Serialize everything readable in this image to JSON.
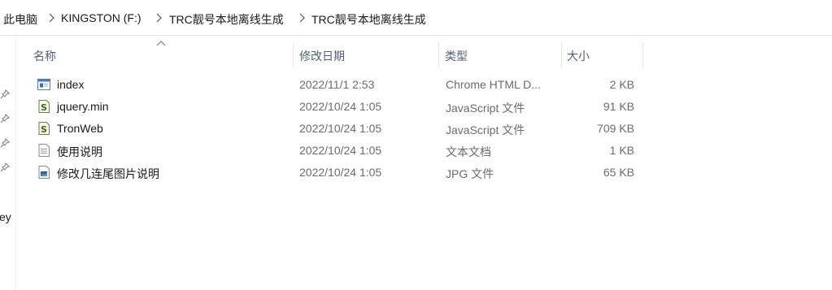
{
  "breadcrumb": {
    "items": [
      "此电脑",
      "KINGSTON (F:)",
      "TRC靓号本地离线生成",
      "TRC靓号本地离线生成"
    ]
  },
  "nav": {
    "partial_text": "key"
  },
  "columns": {
    "name": "名称",
    "date": "修改日期",
    "type": "类型",
    "size": "大小"
  },
  "files": [
    {
      "name": "index",
      "date": "2022/11/1 2:53",
      "type": "Chrome HTML D...",
      "size": "2 KB",
      "icon": "html-file-icon"
    },
    {
      "name": "jquery.min",
      "date": "2022/10/24 1:05",
      "type": "JavaScript 文件",
      "size": "91 KB",
      "icon": "js-file-icon"
    },
    {
      "name": "TronWeb",
      "date": "2022/10/24 1:05",
      "type": "JavaScript 文件",
      "size": "709 KB",
      "icon": "js-file-icon"
    },
    {
      "name": "使用说明",
      "date": "2022/10/24 1:05",
      "type": "文本文档",
      "size": "1 KB",
      "icon": "text-file-icon"
    },
    {
      "name": "修改几连尾图片说明",
      "date": "2022/10/24 1:05",
      "type": "JPG 文件",
      "size": "65 KB",
      "icon": "image-file-icon"
    }
  ],
  "colors": {
    "header_text": "#4c607a",
    "secondary_text": "#6b6b6b",
    "divider": "#e5e5e5"
  }
}
